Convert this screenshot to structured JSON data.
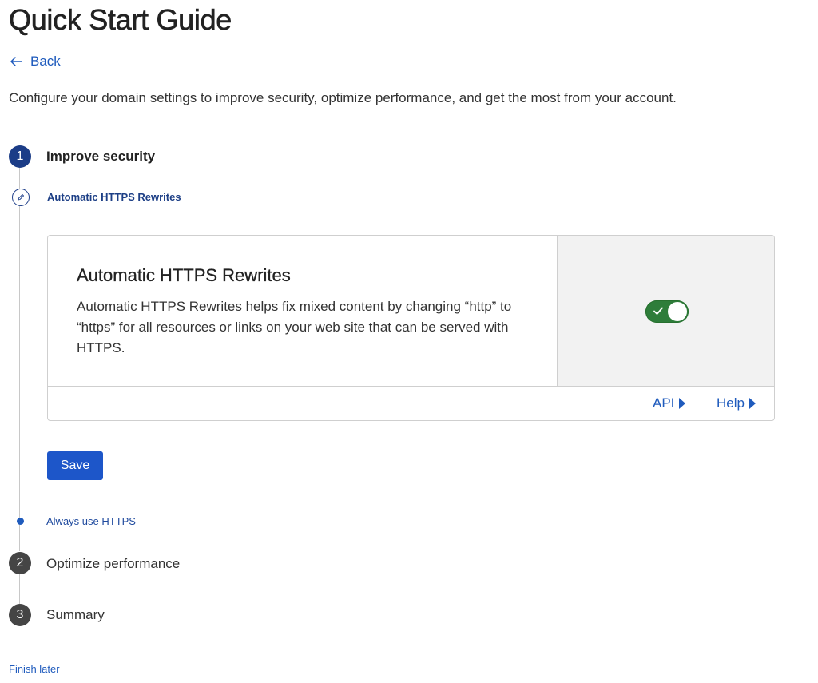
{
  "header": {
    "title": "Quick Start Guide",
    "back_label": "Back",
    "intro": "Configure your domain settings to improve security, optimize performance, and get the most from your account."
  },
  "steps": [
    {
      "number": "1",
      "label": "Improve security",
      "state": "active"
    },
    {
      "number": "2",
      "label": "Optimize performance",
      "state": "todo"
    },
    {
      "number": "3",
      "label": "Summary",
      "state": "todo"
    }
  ],
  "substeps": [
    {
      "label": "Automatic HTTPS Rewrites",
      "state": "current",
      "icon": "pencil-icon"
    },
    {
      "label": "Always use HTTPS",
      "state": "upcoming"
    }
  ],
  "setting_card": {
    "title": "Automatic HTTPS Rewrites",
    "description": "Automatic HTTPS Rewrites helps fix mixed content by changing “http” to “https” for all resources or links on your web site that can be served with HTTPS.",
    "toggle_on": true,
    "links": {
      "api": "API",
      "help": "Help"
    }
  },
  "actions": {
    "save_label": "Save",
    "finish_later": "Finish later"
  },
  "colors": {
    "accent": "#1f5bbd",
    "active_step": "#1b3c87",
    "todo_step": "#454545",
    "toggle_on": "#2e7d3a",
    "save_button": "#1d56c9"
  }
}
